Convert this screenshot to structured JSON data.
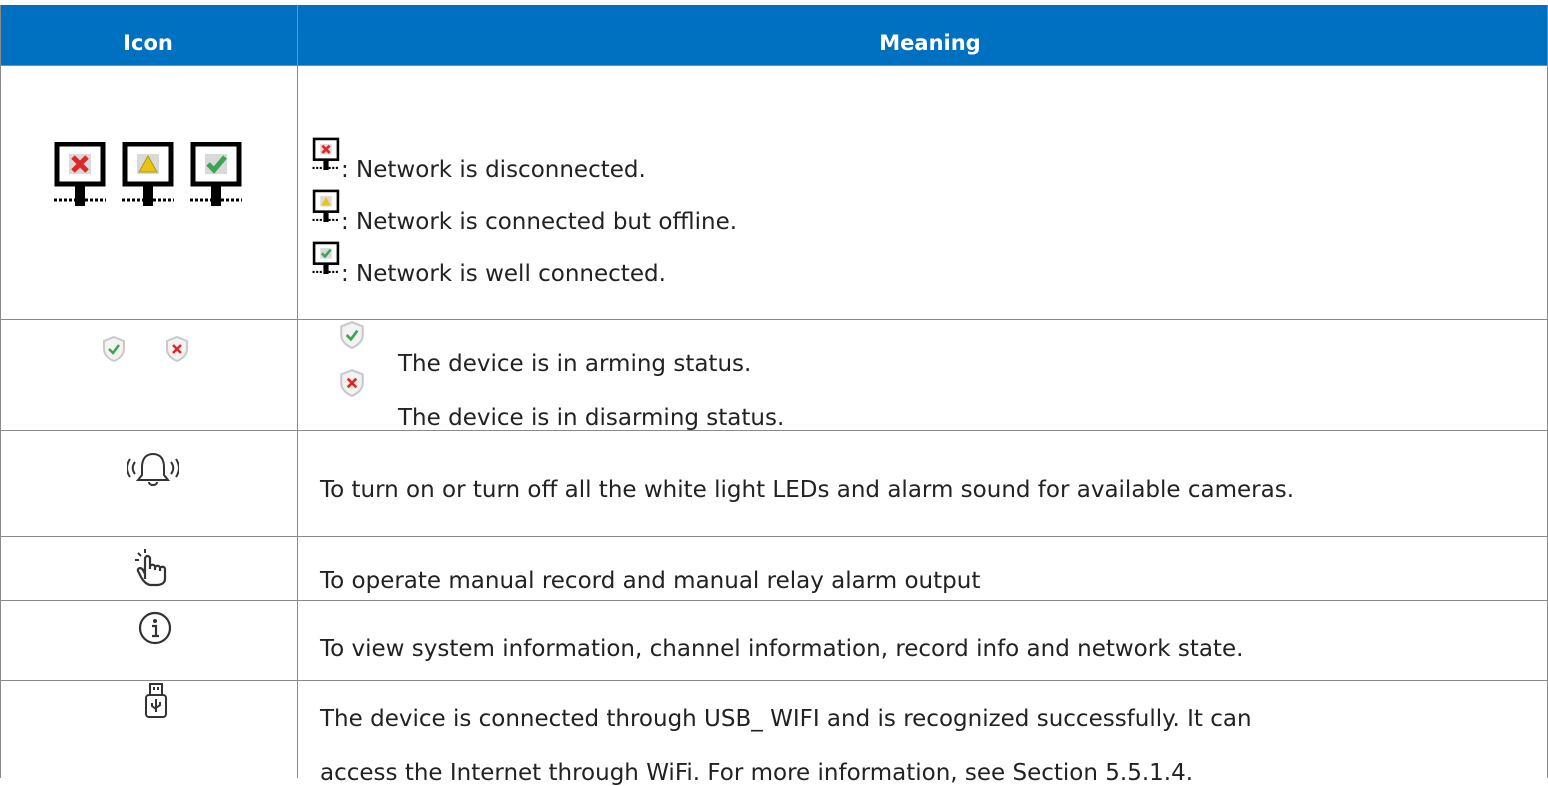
{
  "table": {
    "headers": [
      "Icon",
      "Meaning"
    ],
    "rows": {
      "network": {
        "icons": [
          "network-disconnected-icon",
          "network-offline-icon",
          "network-connected-icon"
        ],
        "lines": [
          ": Network is disconnected.",
          ": Network is connected but offline.",
          ": Network is well connected."
        ]
      },
      "arming": {
        "icons": [
          "shield-check-icon",
          "shield-x-icon"
        ],
        "lines": [
          "The device is in arming status.",
          "The device is in disarming status."
        ]
      },
      "alarm": {
        "icon": "alarm-bell-icon",
        "text": "To turn on or turn off all the white light LEDs and alarm sound for available cameras."
      },
      "manual": {
        "icon": "hand-pointer-icon",
        "text": "To operate manual record and manual relay alarm output"
      },
      "info": {
        "icon": "info-icon",
        "text": "To view system information, channel information, record info and network state."
      },
      "usb": {
        "icon": "usb-wifi-icon",
        "lines": [
          "The device is connected through USB_ WIFI and is recognized successfully. It can",
          "access the Internet through WiFi. For more information, see Section 5.5.1.4."
        ]
      }
    }
  },
  "colors": {
    "header_bg": "#0070c0",
    "red_x": "#e0262a",
    "green_check": "#3aa655",
    "yellow_warn": "#e8c415"
  }
}
